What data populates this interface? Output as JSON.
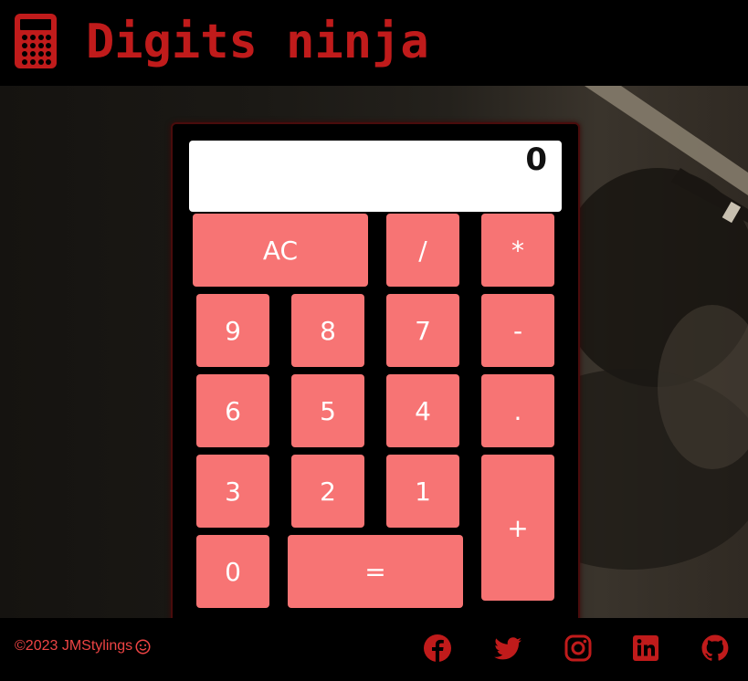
{
  "header": {
    "title": "Digits ninja",
    "logo_icon": "calculator-icon"
  },
  "calculator": {
    "display_value": "0",
    "keys": {
      "clear": "AC",
      "divide": "/",
      "multiply": "*",
      "nine": "9",
      "eight": "8",
      "seven": "7",
      "minus": "-",
      "six": "6",
      "five": "5",
      "four": "4",
      "dot": ".",
      "three": "3",
      "two": "2",
      "one": "1",
      "plus": "+",
      "zero": "0",
      "equals": "="
    }
  },
  "footer": {
    "copyright": "©2023 JMStylings",
    "smiley_icon": "smiley-icon",
    "social_icons": [
      "facebook-icon",
      "twitter-icon",
      "instagram-icon",
      "linkedin-icon",
      "github-icon"
    ]
  },
  "colors": {
    "brand_red": "#c01b1b",
    "key_fill": "#f77474",
    "footer_text": "#ee4444"
  }
}
